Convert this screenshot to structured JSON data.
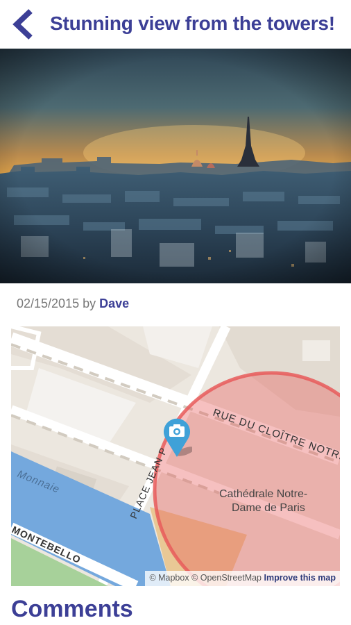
{
  "header": {
    "title": "Stunning view from the towers!",
    "back_icon": "chevron-left-icon"
  },
  "photo": {
    "description_icon": "photo"
  },
  "meta": {
    "date": "02/15/2015",
    "by": "by",
    "author": "Dave"
  },
  "map": {
    "street_labels": [
      "RUE DU CLOÎTRE NOTRE",
      "PLACE JEAN P",
      "Monnaie",
      "MONTEBELLO"
    ],
    "poi_label_line1": "Cathédrale Notre-",
    "poi_label_line2": "Dame de Paris",
    "marker_icon": "camera-icon",
    "attribution": {
      "mapbox": "© Mapbox",
      "osm": "© OpenStreetMap",
      "improve": "Improve this map"
    },
    "colors": {
      "water": "#74a8dd",
      "circle": "#e85a5a",
      "land": "#ece7df"
    }
  },
  "comments": {
    "title": "Comments"
  },
  "colors": {
    "accent": "#3c3f96"
  }
}
